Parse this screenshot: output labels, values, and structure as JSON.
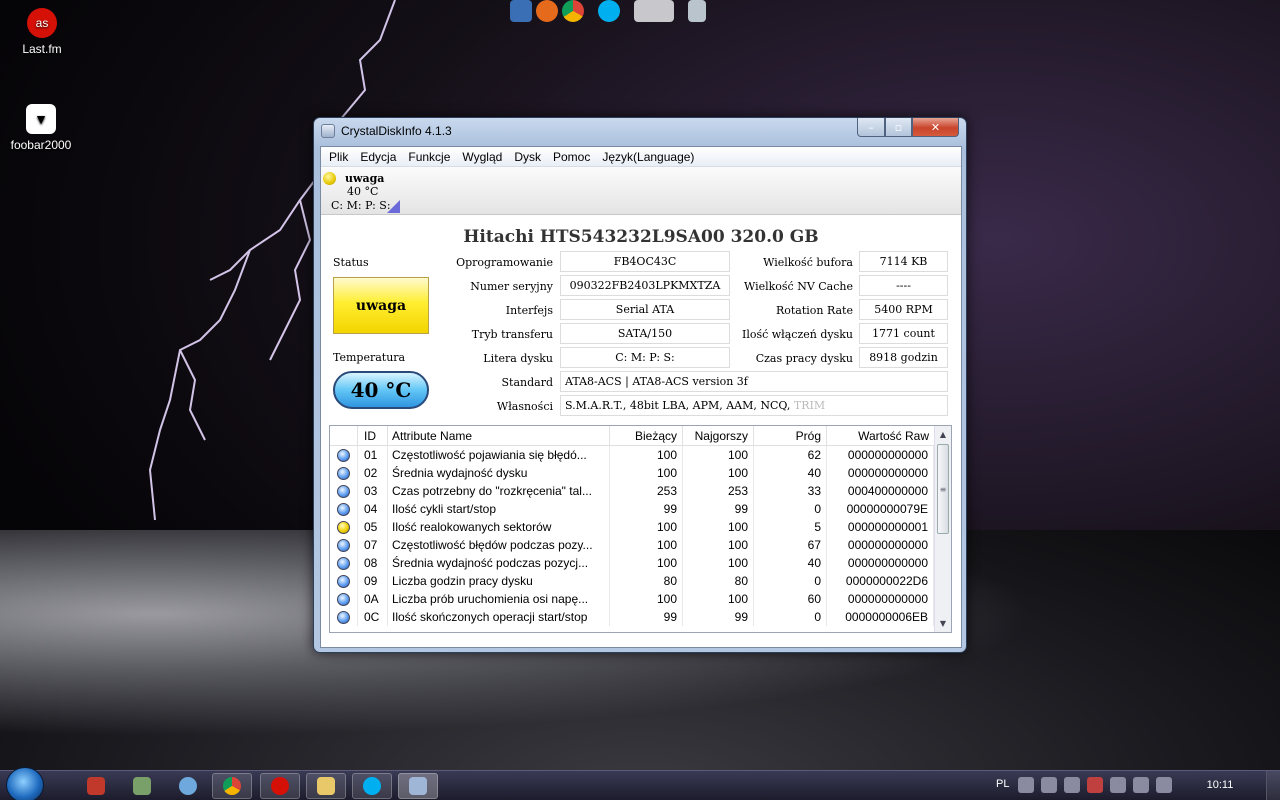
{
  "desktop": {
    "icons": [
      {
        "label": "Last.fm",
        "icon": "lastfm-icon",
        "color": "#d51007"
      },
      {
        "label": "foobar2000",
        "icon": "foobar2000-icon",
        "color": "#ffffff"
      }
    ],
    "top_icons": [
      "thunderbird-icon",
      "firefox-icon",
      "chrome-icon",
      "skype-icon",
      "drive-icon",
      "recycle-bin-icon"
    ]
  },
  "window": {
    "title": "CrystalDiskInfo 4.1.3",
    "caption": {
      "minimize": "–",
      "maximize": "▫",
      "close": "✕"
    },
    "menu": [
      "Plik",
      "Edycja",
      "Funkcje",
      "Wygląd",
      "Dysk",
      "Pomoc",
      "Język(Language)"
    ],
    "diskbar": {
      "status": "uwaga",
      "temp": "40 °C",
      "letters": "C: M: P: S:"
    },
    "model": "Hitachi HTS543232L9SA00  320.0 GB",
    "status_label": "Status",
    "status_value": "uwaga",
    "temp_label": "Temperatura",
    "temp_value": "40 °C",
    "fields": {
      "firmware": {
        "label": "Oprogramowanie",
        "value": "FB4OC43C"
      },
      "serial": {
        "label": "Numer seryjny",
        "value": "090322FB2403LPKMXTZA"
      },
      "interface": {
        "label": "Interfejs",
        "value": "Serial ATA"
      },
      "transfer": {
        "label": "Tryb transferu",
        "value": "SATA/150"
      },
      "drive_letter": {
        "label": "Litera dysku",
        "value": "C: M: P: S:"
      },
      "standard": {
        "label": "Standard",
        "value": "ATA8-ACS | ATA8-ACS version 3f"
      },
      "features": {
        "label": "Własności",
        "value": "S.M.A.R.T., 48bit LBA, APM, AAM, NCQ,",
        "value_dim": "TRIM"
      },
      "buffer": {
        "label": "Wielkość bufora",
        "value": "7114 KB"
      },
      "nv_cache": {
        "label": "Wielkość NV Cache",
        "value": "----"
      },
      "rotation": {
        "label": "Rotation Rate",
        "value": "5400 RPM"
      },
      "power_on_count": {
        "label": "Ilość włączeń dysku",
        "value": "1771 count"
      },
      "power_on_hours": {
        "label": "Czas pracy dysku",
        "value": "8918 godzin"
      }
    },
    "table": {
      "headers": [
        "ID",
        "Attribute Name",
        "Bieżący",
        "Najgorszy",
        "Próg",
        "Wartość Raw"
      ],
      "rows": [
        {
          "status": "blue",
          "id": "01",
          "name": "Częstotliwość pojawiania się błędó...",
          "cur": "100",
          "worst": "100",
          "thr": "62",
          "raw": "000000000000"
        },
        {
          "status": "blue",
          "id": "02",
          "name": "Średnia wydajność dysku",
          "cur": "100",
          "worst": "100",
          "thr": "40",
          "raw": "000000000000"
        },
        {
          "status": "blue",
          "id": "03",
          "name": "Czas potrzebny do \"rozkręcenia\" tal...",
          "cur": "253",
          "worst": "253",
          "thr": "33",
          "raw": "000400000000"
        },
        {
          "status": "blue",
          "id": "04",
          "name": "Ilość cykli start/stop",
          "cur": "99",
          "worst": "99",
          "thr": "0",
          "raw": "00000000079E"
        },
        {
          "status": "yellow",
          "id": "05",
          "name": "Ilość realokowanych sektorów",
          "cur": "100",
          "worst": "100",
          "thr": "5",
          "raw": "000000000001"
        },
        {
          "status": "blue",
          "id": "07",
          "name": "Częstotliwość błędów podczas pozy...",
          "cur": "100",
          "worst": "100",
          "thr": "67",
          "raw": "000000000000"
        },
        {
          "status": "blue",
          "id": "08",
          "name": "Średnia wydajność podczas pozycj...",
          "cur": "100",
          "worst": "100",
          "thr": "40",
          "raw": "000000000000"
        },
        {
          "status": "blue",
          "id": "09",
          "name": "Liczba godzin pracy dysku",
          "cur": "80",
          "worst": "80",
          "thr": "0",
          "raw": "0000000022D6"
        },
        {
          "status": "blue",
          "id": "0A",
          "name": "Liczba prób uruchomienia osi napę...",
          "cur": "100",
          "worst": "100",
          "thr": "60",
          "raw": "000000000000"
        },
        {
          "status": "blue",
          "id": "0C",
          "name": "Ilość skończonych operacji start/stop",
          "cur": "99",
          "worst": "99",
          "thr": "0",
          "raw": "0000000006EB"
        }
      ]
    }
  },
  "taskbar": {
    "apps": [
      "thunderbird-icon",
      "process-explorer-icon",
      "itunes-icon",
      "chrome-icon",
      "lastfm-icon",
      "explorer-icon",
      "skype-icon",
      "crystaldiskinfo-icon"
    ],
    "language": "PL",
    "clock": "10:11"
  }
}
